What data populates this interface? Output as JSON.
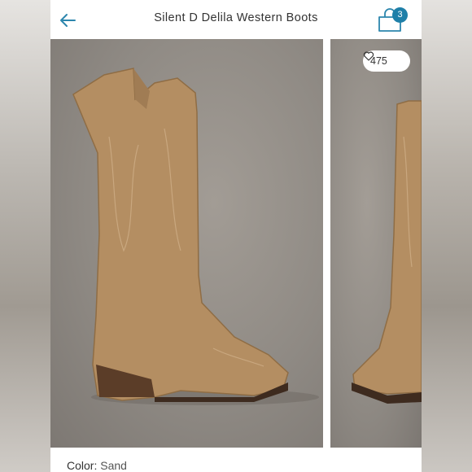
{
  "header": {
    "title": "Silent D Delila Western Boots",
    "back_icon": "arrow-left-icon",
    "bag_icon": "shopping-bag-icon",
    "bag_count": "3"
  },
  "gallery": {
    "likes_count": "475",
    "like_icon": "heart-outline-icon"
  },
  "product": {
    "color_label": "Color:",
    "color_value": "Sand"
  },
  "colors": {
    "accent": "#1e7fa8",
    "boot_suede": "#b48e62",
    "background_gray": "#8f8a84"
  }
}
